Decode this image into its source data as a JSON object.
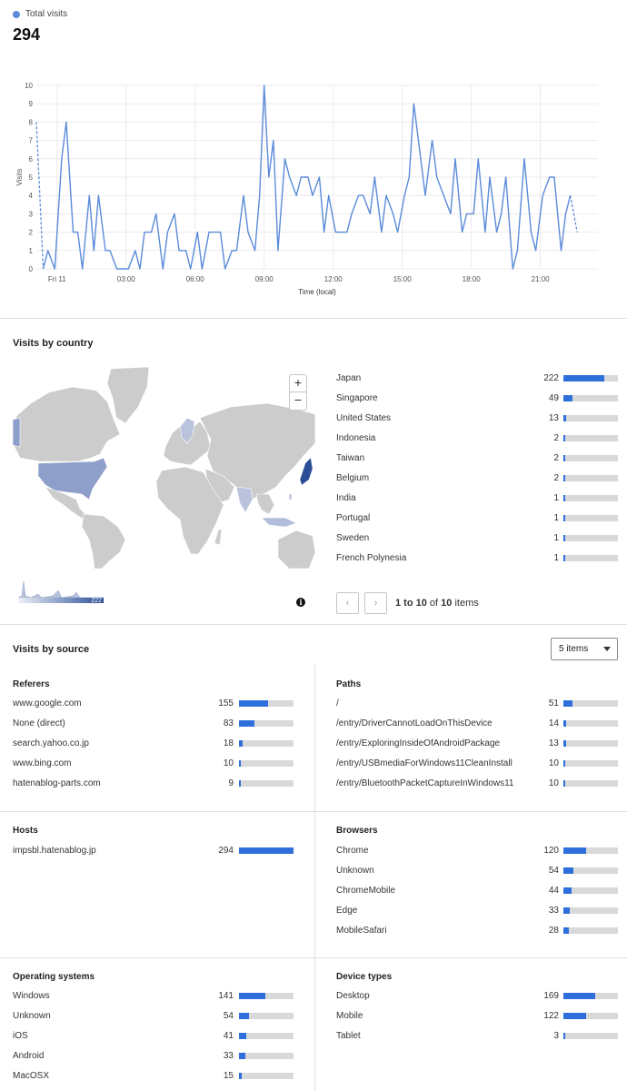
{
  "total": {
    "legend_label": "Total visits",
    "count": "294",
    "series_color": "#5b8bd9"
  },
  "chart_data": {
    "type": "line",
    "ylabel": "Visits",
    "xlabel": "Time (local)",
    "ylim": [
      0,
      10
    ],
    "y_ticks": [
      "0",
      "1",
      "2",
      "3",
      "4",
      "5",
      "6",
      "7",
      "8",
      "9",
      "10"
    ],
    "x_tick_labels": [
      "Fri 11",
      "03:00",
      "06:00",
      "09:00",
      "12:00",
      "15:00",
      "18:00",
      "21:00"
    ],
    "x_tick_hours": [
      0,
      3,
      6,
      9,
      12,
      15,
      18,
      21
    ],
    "x_range_hours": [
      -0.9,
      23.5
    ],
    "grid": true,
    "series": [
      {
        "points": [
          [
            -0.9,
            8
          ],
          [
            -0.6,
            0
          ],
          [
            -0.4,
            1
          ],
          [
            -0.1,
            0
          ],
          [
            0.2,
            6
          ],
          [
            0.4,
            8
          ],
          [
            0.7,
            2
          ],
          [
            0.9,
            2
          ],
          [
            1.1,
            0
          ],
          [
            1.4,
            4
          ],
          [
            1.6,
            1
          ],
          [
            1.8,
            4
          ],
          [
            2.1,
            1
          ],
          [
            2.3,
            1
          ],
          [
            2.6,
            0
          ],
          [
            2.8,
            0
          ],
          [
            3.1,
            0
          ],
          [
            3.4,
            1
          ],
          [
            3.6,
            0
          ],
          [
            3.8,
            2
          ],
          [
            4.1,
            2
          ],
          [
            4.3,
            3
          ],
          [
            4.6,
            0
          ],
          [
            4.8,
            2
          ],
          [
            5.1,
            3
          ],
          [
            5.3,
            1
          ],
          [
            5.6,
            1
          ],
          [
            5.8,
            0
          ],
          [
            6.1,
            2
          ],
          [
            6.3,
            0
          ],
          [
            6.6,
            2
          ],
          [
            6.8,
            2
          ],
          [
            7.1,
            2
          ],
          [
            7.3,
            0
          ],
          [
            7.6,
            1
          ],
          [
            7.8,
            1
          ],
          [
            8.1,
            4
          ],
          [
            8.3,
            2
          ],
          [
            8.6,
            1
          ],
          [
            8.8,
            4
          ],
          [
            9.0,
            10
          ],
          [
            9.2,
            5
          ],
          [
            9.4,
            7
          ],
          [
            9.6,
            1
          ],
          [
            9.9,
            6
          ],
          [
            10.1,
            5
          ],
          [
            10.4,
            4
          ],
          [
            10.6,
            5
          ],
          [
            10.9,
            5
          ],
          [
            11.1,
            4
          ],
          [
            11.4,
            5
          ],
          [
            11.6,
            2
          ],
          [
            11.8,
            4
          ],
          [
            12.1,
            2
          ],
          [
            12.3,
            2
          ],
          [
            12.6,
            2
          ],
          [
            12.8,
            3
          ],
          [
            13.1,
            4
          ],
          [
            13.3,
            4
          ],
          [
            13.6,
            3
          ],
          [
            13.8,
            5
          ],
          [
            14.1,
            2
          ],
          [
            14.3,
            4
          ],
          [
            14.6,
            3
          ],
          [
            14.8,
            2
          ],
          [
            15.1,
            4
          ],
          [
            15.3,
            5
          ],
          [
            15.5,
            9
          ],
          [
            15.8,
            6
          ],
          [
            16.0,
            4
          ],
          [
            16.3,
            7
          ],
          [
            16.5,
            5
          ],
          [
            16.8,
            4
          ],
          [
            17.1,
            3
          ],
          [
            17.3,
            6
          ],
          [
            17.6,
            2
          ],
          [
            17.8,
            3
          ],
          [
            18.1,
            3
          ],
          [
            18.3,
            6
          ],
          [
            18.6,
            2
          ],
          [
            18.8,
            5
          ],
          [
            19.1,
            2
          ],
          [
            19.3,
            3
          ],
          [
            19.5,
            5
          ],
          [
            19.8,
            0
          ],
          [
            20.0,
            1
          ],
          [
            20.3,
            6
          ],
          [
            20.6,
            2
          ],
          [
            20.8,
            1
          ],
          [
            21.1,
            4
          ],
          [
            21.4,
            5
          ],
          [
            21.6,
            5
          ],
          [
            21.9,
            1
          ],
          [
            22.1,
            3
          ],
          [
            22.3,
            4
          ],
          [
            22.6,
            2
          ]
        ]
      }
    ]
  },
  "country": {
    "title": "Visits by country",
    "legend_max": "222",
    "pager": {
      "prev": "‹",
      "next": "›",
      "range": "1 to 10",
      "of": "of",
      "total": "10",
      "items": "items"
    },
    "rows": [
      {
        "name": "Japan",
        "value": "222",
        "frac": 0.75
      },
      {
        "name": "Singapore",
        "value": "49",
        "frac": 0.16
      },
      {
        "name": "United States",
        "value": "13",
        "frac": 0.045
      },
      {
        "name": "Indonesia",
        "value": "2",
        "frac": 0.015
      },
      {
        "name": "Taiwan",
        "value": "2",
        "frac": 0.015
      },
      {
        "name": "Belgium",
        "value": "2",
        "frac": 0.015
      },
      {
        "name": "India",
        "value": "1",
        "frac": 0.01
      },
      {
        "name": "Portugal",
        "value": "1",
        "frac": 0.01
      },
      {
        "name": "Sweden",
        "value": "1",
        "frac": 0.01
      },
      {
        "name": "French Polynesia",
        "value": "1",
        "frac": 0.01
      }
    ]
  },
  "source": {
    "title": "Visits by source",
    "select_value": "5 items",
    "referers": {
      "title": "Referers",
      "rows": [
        {
          "name": "www.google.com",
          "value": "155",
          "frac": 0.53
        },
        {
          "name": "None (direct)",
          "value": "83",
          "frac": 0.28
        },
        {
          "name": "search.yahoo.co.jp",
          "value": "18",
          "frac": 0.06
        },
        {
          "name": "www.bing.com",
          "value": "10",
          "frac": 0.035
        },
        {
          "name": "hatenablog-parts.com",
          "value": "9",
          "frac": 0.03
        }
      ]
    },
    "paths": {
      "title": "Paths",
      "rows": [
        {
          "name": "/",
          "value": "51",
          "frac": 0.17
        },
        {
          "name": "/entry/DriverCannotLoadOnThisDevice",
          "value": "14",
          "frac": 0.05
        },
        {
          "name": "/entry/ExploringInsideOfAndroidPackage",
          "value": "13",
          "frac": 0.045
        },
        {
          "name": "/entry/USBmediaForWindows11CleanInstall",
          "value": "10",
          "frac": 0.035
        },
        {
          "name": "/entry/BluetoothPacketCaptureInWindows11",
          "value": "10",
          "frac": 0.035
        }
      ]
    },
    "hosts": {
      "title": "Hosts",
      "rows": [
        {
          "name": "impsbl.hatenablog.jp",
          "value": "294",
          "frac": 1.0
        }
      ]
    },
    "browsers": {
      "title": "Browsers",
      "rows": [
        {
          "name": "Chrome",
          "value": "120",
          "frac": 0.41
        },
        {
          "name": "Unknown",
          "value": "54",
          "frac": 0.18
        },
        {
          "name": "ChromeMobile",
          "value": "44",
          "frac": 0.15
        },
        {
          "name": "Edge",
          "value": "33",
          "frac": 0.11
        },
        {
          "name": "MobileSafari",
          "value": "28",
          "frac": 0.095
        }
      ]
    },
    "os": {
      "title": "Operating systems",
      "rows": [
        {
          "name": "Windows",
          "value": "141",
          "frac": 0.48
        },
        {
          "name": "Unknown",
          "value": "54",
          "frac": 0.18
        },
        {
          "name": "iOS",
          "value": "41",
          "frac": 0.14
        },
        {
          "name": "Android",
          "value": "33",
          "frac": 0.11
        },
        {
          "name": "MacOSX",
          "value": "15",
          "frac": 0.05
        }
      ]
    },
    "devices": {
      "title": "Device types",
      "rows": [
        {
          "name": "Desktop",
          "value": "169",
          "frac": 0.575
        },
        {
          "name": "Mobile",
          "value": "122",
          "frac": 0.415
        },
        {
          "name": "Tablet",
          "value": "3",
          "frac": 0.01
        }
      ]
    }
  },
  "colors": {
    "bar_fill": "#2e6fdc",
    "bar_track": "#d9d9d9",
    "map_land": "#cccccc",
    "map_usa": "#8e9fc9",
    "map_japan": "#2a4e96",
    "map_singapore": "#b2bddb"
  }
}
